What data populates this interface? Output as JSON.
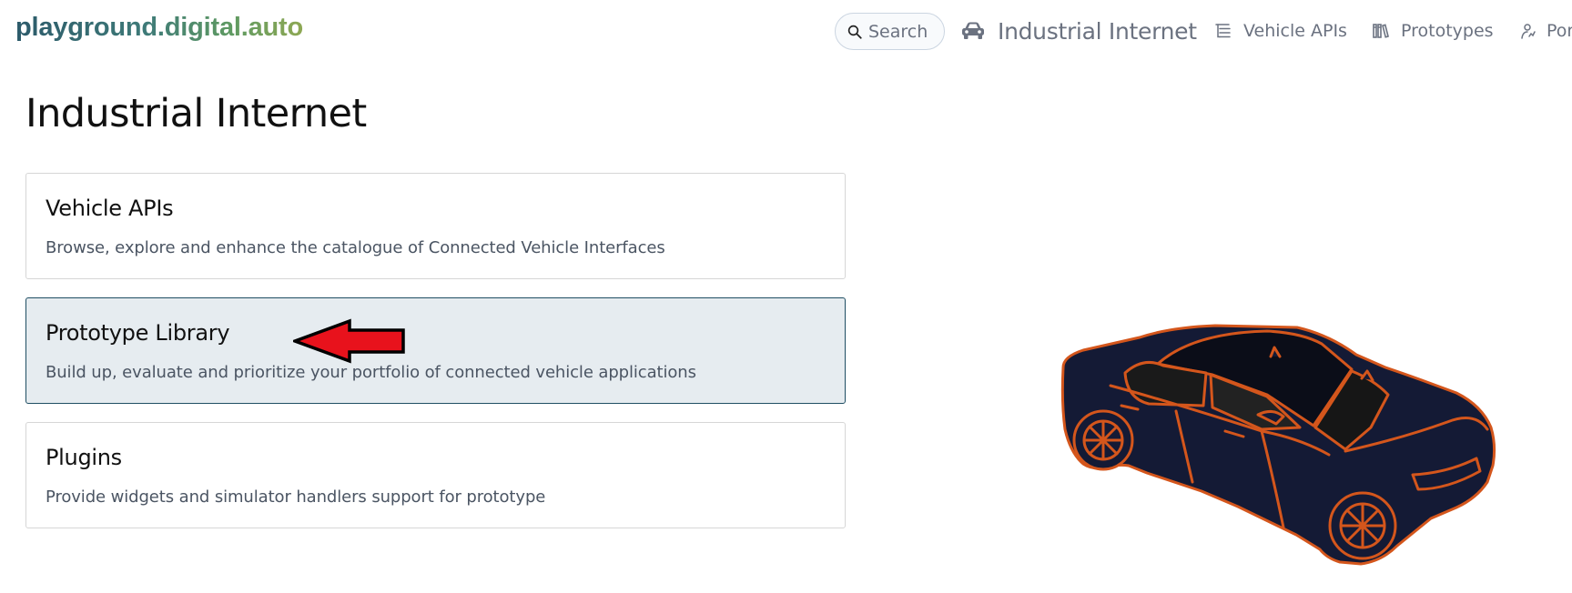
{
  "header": {
    "logo": "playground.digital.auto",
    "search_placeholder": "Search",
    "model_name": "Industrial Internet",
    "nav": {
      "vehicle_apis": "Vehicle APIs",
      "prototypes": "Prototypes",
      "portfolio": "Por"
    }
  },
  "main": {
    "title": "Industrial Internet",
    "cards": [
      {
        "title": "Vehicle APIs",
        "description": "Browse, explore and enhance the catalogue of Connected Vehicle Interfaces"
      },
      {
        "title": "Prototype Library",
        "description": "Build up, evaluate and prioritize your portfolio of connected vehicle applications",
        "selected": true
      },
      {
        "title": "Plugins",
        "description": "Provide widgets and simulator handlers support for prototype"
      }
    ]
  },
  "colors": {
    "accent": "#1f4e63",
    "selected_card_bg": "#e6ecf0",
    "annotation_arrow": "#e8121c",
    "car_body": "#141a35",
    "car_outline": "#d4561c"
  },
  "icons": {
    "search": "search-icon",
    "model": "car-icon",
    "vehicle_apis": "list-tree-icon",
    "prototypes": "library-icon",
    "portfolio": "user-chart-icon",
    "annotation": "red-arrow-icon"
  }
}
